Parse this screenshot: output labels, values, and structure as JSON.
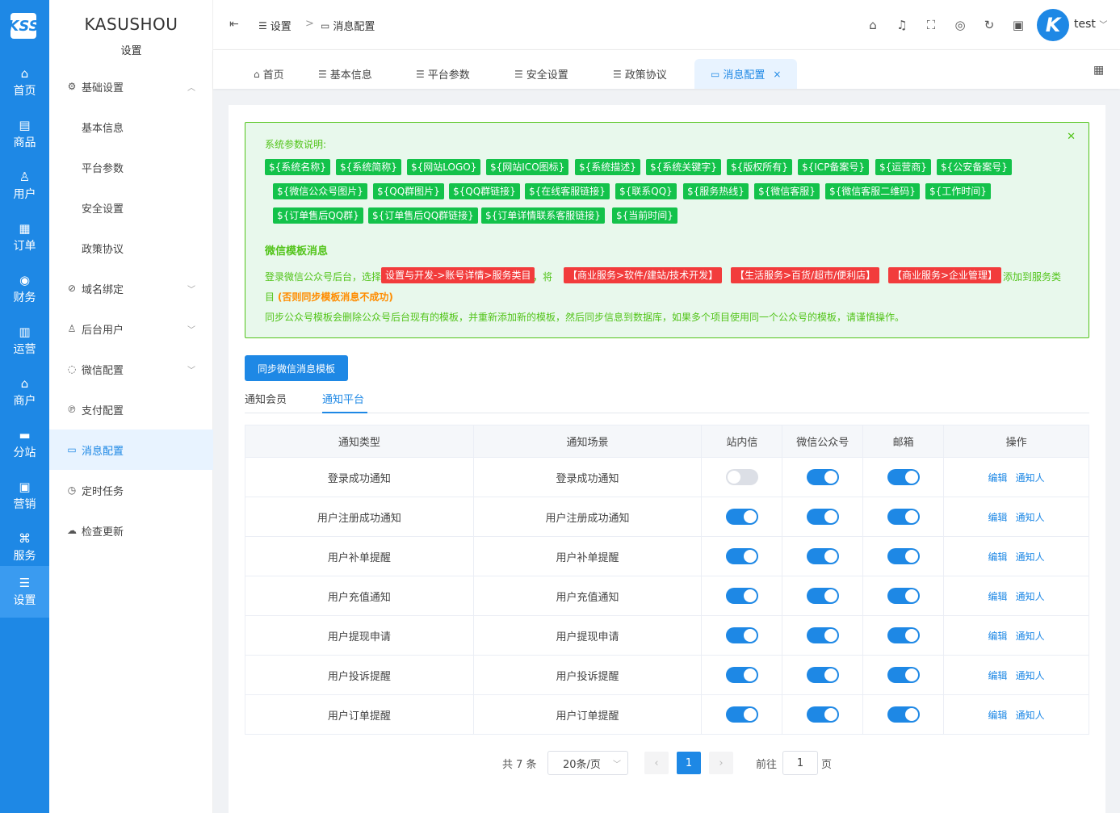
{
  "rail": {
    "logo": "KSS",
    "items": [
      {
        "label": "首页",
        "icon": "home-icon"
      },
      {
        "label": "商品",
        "icon": "goods-icon"
      },
      {
        "label": "用户",
        "icon": "user-icon"
      },
      {
        "label": "订单",
        "icon": "order-icon"
      },
      {
        "label": "财务",
        "icon": "finance-icon"
      },
      {
        "label": "运营",
        "icon": "operation-icon"
      },
      {
        "label": "商户",
        "icon": "merchant-icon"
      },
      {
        "label": "分站",
        "icon": "substation-icon"
      },
      {
        "label": "营销",
        "icon": "marketing-icon"
      },
      {
        "label": "服务",
        "icon": "service-icon"
      },
      {
        "label": "设置",
        "icon": "settings-icon"
      }
    ]
  },
  "sidebar": {
    "title": "KASUSHOU",
    "subtitle": "设置",
    "items": [
      {
        "label": "基础设置"
      },
      {
        "label": "基本信息"
      },
      {
        "label": "平台参数"
      },
      {
        "label": "安全设置"
      },
      {
        "label": "政策协议"
      },
      {
        "label": "域名绑定"
      },
      {
        "label": "后台用户"
      },
      {
        "label": "微信配置"
      },
      {
        "label": "支付配置"
      },
      {
        "label": "消息配置"
      },
      {
        "label": "定时任务"
      },
      {
        "label": "检查更新"
      }
    ]
  },
  "header": {
    "breadcrumb": [
      "设置",
      "消息配置"
    ],
    "user": "test"
  },
  "tabs": [
    "首页",
    "基本信息",
    "平台参数",
    "安全设置",
    "政策协议",
    "消息配置"
  ],
  "alert": {
    "title": "系统参数说明:",
    "tags_row1": [
      "${系统名称}",
      "${系统简称}",
      "${网站LOGO}",
      "${网站ICO图标}",
      "${系统描述}",
      "${系统关键字}",
      "${版权所有}",
      "${ICP备案号}",
      "${运营商}",
      "${公安备案号}"
    ],
    "tags_row2": [
      "${微信公众号图片}",
      "${QQ群图片}",
      "${QQ群链接}",
      "${在线客服链接}",
      "${联系QQ}",
      "${服务热线}",
      "${微信客服}",
      "${微信客服二维码}",
      "${工作时间}"
    ],
    "tags_row3": [
      "${订单售后QQ群}",
      "${订单售后QQ群链接}",
      "${订单详情联系客服链接}",
      "${当前时间}"
    ],
    "section_title": "微信模板消息",
    "line1_prefix": "登录微信公众号后台，选择",
    "line1_tag1": "设置与开发->账号详情>服务类目",
    "line1_mid": "，将",
    "line1_tag2": "【商业服务>软件/建站/技术开发】",
    "line1_tag3": "【生活服务>百货/超市/便利店】",
    "line1_tag4": "【商业服务>企业管理】",
    "line1_suffix": "添加到服务类",
    "line2_prefix": "目",
    "line2_warn": "(否则同步模板消息不成功)",
    "line3": "同步公众号模板会删除公众号后台现有的模板，并重新添加新的模板，然后同步信息到数据库，如果多个项目使用同一个公众号的模板，请谨慎操作。"
  },
  "sync_button": "同步微信消息模板",
  "subtabs": [
    "通知会员",
    "通知平台"
  ],
  "table": {
    "headers": [
      "通知类型",
      "通知场景",
      "站内信",
      "微信公众号",
      "邮箱",
      "操作"
    ],
    "rows": [
      {
        "type": "登录成功通知",
        "scene": "登录成功通知",
        "site": false,
        "wechat": true,
        "email": true
      },
      {
        "type": "用户注册成功通知",
        "scene": "用户注册成功通知",
        "site": true,
        "wechat": true,
        "email": true
      },
      {
        "type": "用户补单提醒",
        "scene": "用户补单提醒",
        "site": true,
        "wechat": true,
        "email": true
      },
      {
        "type": "用户充值通知",
        "scene": "用户充值通知",
        "site": true,
        "wechat": true,
        "email": true
      },
      {
        "type": "用户提现申请",
        "scene": "用户提现申请",
        "site": true,
        "wechat": true,
        "email": true
      },
      {
        "type": "用户投诉提醒",
        "scene": "用户投诉提醒",
        "site": true,
        "wechat": true,
        "email": true
      },
      {
        "type": "用户订单提醒",
        "scene": "用户订单提醒",
        "site": true,
        "wechat": true,
        "email": true
      }
    ],
    "action_edit": "编辑",
    "action_notify": "通知人"
  },
  "pagination": {
    "total": "共 7 条",
    "page_size": "20条/页",
    "current": "1",
    "goto_label": "前往",
    "goto_value": "1",
    "page_unit": "页"
  }
}
